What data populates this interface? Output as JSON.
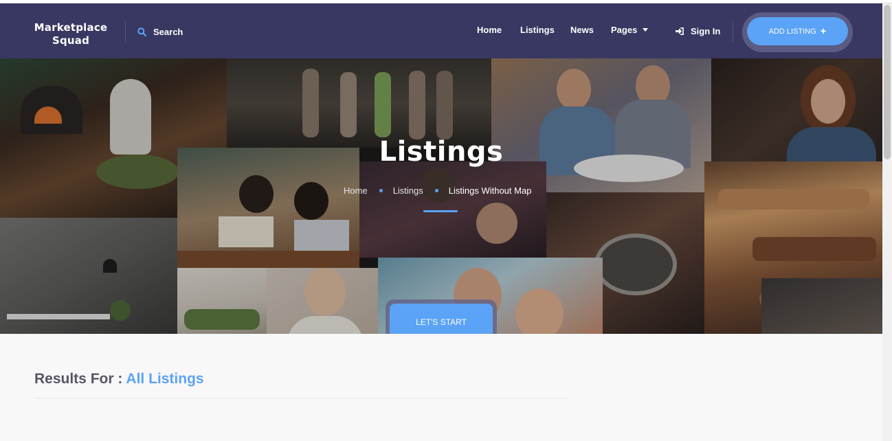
{
  "brand": {
    "logo_line1": "Marketplace",
    "logo_line2": "Squad"
  },
  "header": {
    "search_label": "Search",
    "menu": {
      "home": "Home",
      "listings": "Listings",
      "news": "News",
      "pages": "Pages"
    },
    "sign_in": "Sign In",
    "add_listing": "ADD LISTING",
    "add_listing_icon": "+"
  },
  "hero": {
    "title": "Listings",
    "breadcrumb": {
      "home": "Home",
      "listings": "Listings",
      "current": "Listings Without Map"
    },
    "cta": "LET'S START"
  },
  "results": {
    "prefix": "Results For :",
    "value": "All Listings"
  },
  "colors": {
    "navbar": "#383862",
    "accent": "#5ba3f6",
    "page_bg": "#f8f8f8"
  },
  "icons": [
    "search-icon",
    "chevron-down-icon",
    "sign-in-icon",
    "plus-icon"
  ]
}
